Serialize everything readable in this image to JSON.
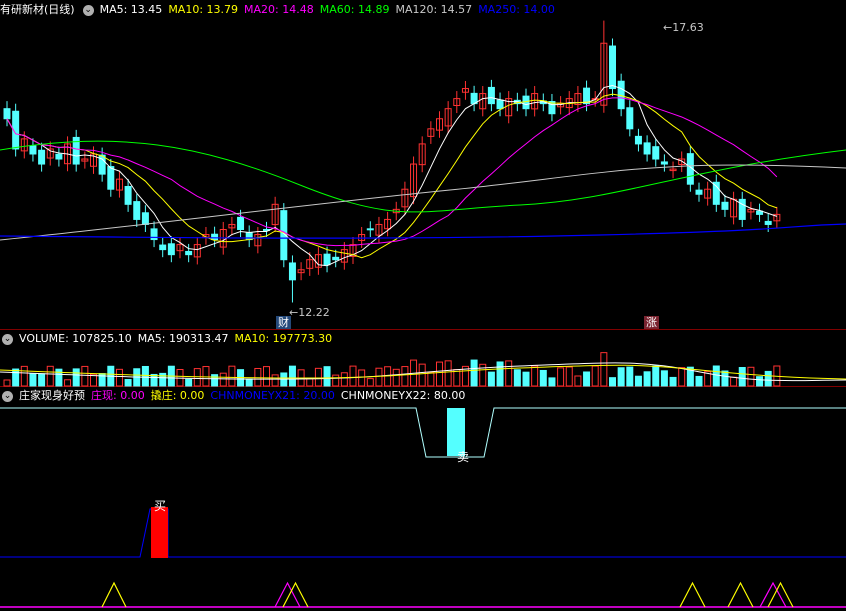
{
  "main": {
    "title": "有研新材(日线)",
    "ma": [
      {
        "label": "MA5: 13.45",
        "color": "#ffffff"
      },
      {
        "label": "MA10: 13.79",
        "color": "#ffff00"
      },
      {
        "label": "MA20: 14.48",
        "color": "#ff00ff"
      },
      {
        "label": "MA60: 14.89",
        "color": "#00ff00"
      },
      {
        "label": "MA120: 14.57",
        "color": "#c8c8c8"
      },
      {
        "label": "MA250: 14.00",
        "color": "#0000ff"
      }
    ],
    "high_label": "17.63",
    "low_label": "12.22",
    "tag_cai": "财",
    "tag_zhang": "涨"
  },
  "volume": {
    "labels": [
      {
        "text": "VOLUME: 107825.10",
        "color": "#ffffff"
      },
      {
        "text": "MA5: 190313.47",
        "color": "#ffffff"
      },
      {
        "text": "MA10: 197773.30",
        "color": "#ffff00"
      }
    ]
  },
  "indicator": {
    "title": "庄家现身好预",
    "items": [
      {
        "text": "庄现: 0.00",
        "color": "#ff00ff"
      },
      {
        "text": "撬庄: 0.00",
        "color": "#ffff00"
      },
      {
        "text": "CHNMONEYX21: 20.00",
        "color": "#0000ff"
      },
      {
        "text": "CHNMONEYX22: 80.00",
        "color": "#ffffff"
      }
    ],
    "sell_label": "卖",
    "buy_label": "买"
  },
  "colors": {
    "up": "#ff3232",
    "down": "#54ffff",
    "bg": "#000000",
    "axis": "#800000"
  },
  "icons": [
    "collapse-icon"
  ]
}
